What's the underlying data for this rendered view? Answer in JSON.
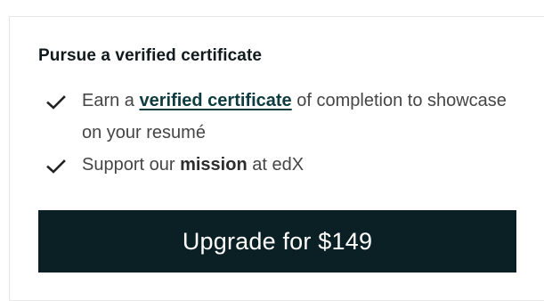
{
  "card": {
    "title": "Pursue a verified certificate",
    "benefits": [
      {
        "icon": "checkmark-icon",
        "before": "Earn a ",
        "link": "verified certificate",
        "after": " of completion to showcase on your resumé"
      },
      {
        "icon": "checkmark-icon",
        "before": "Support our ",
        "strong": "mission",
        "after": " at edX"
      }
    ],
    "upgrade_button": "Upgrade for $149"
  },
  "colors": {
    "button_background": "#0b2024",
    "button_text": "#ffffff",
    "title": "#111a1c",
    "body_text": "#454545",
    "link": "#0d3b3e"
  }
}
